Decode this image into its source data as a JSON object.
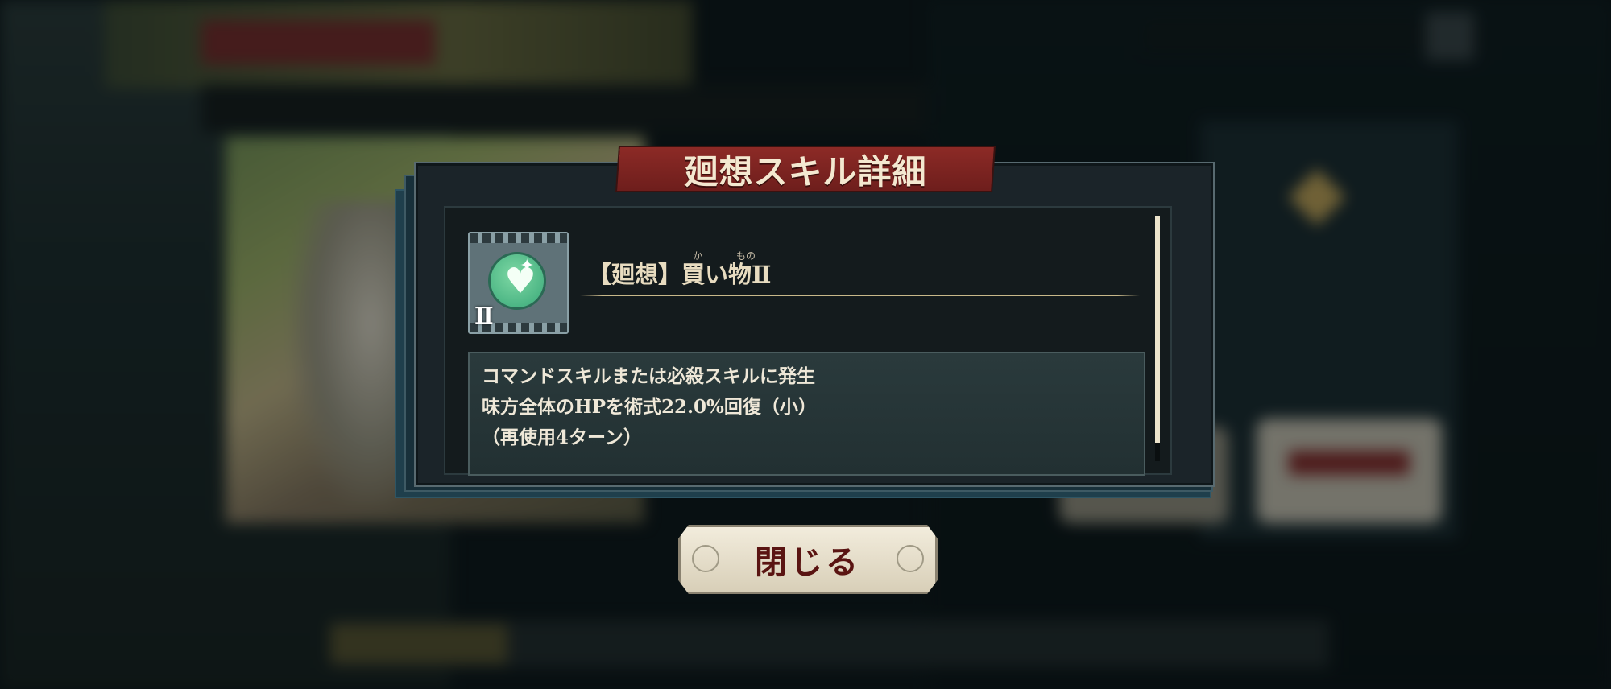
{
  "dialog": {
    "title": "廻想スキル詳細",
    "skill": {
      "rank": "Ⅱ",
      "name": "【廻想】買い物Ⅱ",
      "ruby_1": "か",
      "ruby_2": "もの",
      "icon": "heart-sparkle-icon"
    },
    "description": {
      "line1": "コマンドスキルまたは必殺スキルに発生",
      "line2": "味方全体のHPを術式22.0%回復（小）",
      "line3": "（再使用4ターン）"
    },
    "close_label": "閉じる"
  },
  "colors": {
    "banner": "#8c2a26",
    "icon_green": "#38a878",
    "text": "#efe8d8",
    "close_text": "#5a1412"
  }
}
